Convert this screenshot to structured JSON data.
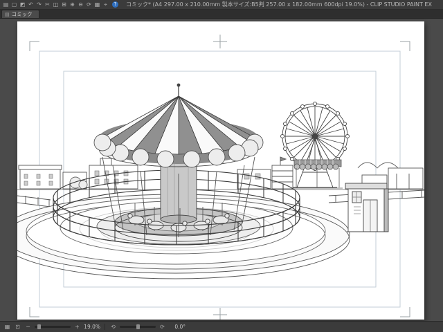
{
  "window": {
    "title": "コミック* (A4 297.00 x 210.00mm 製本サイズ:B5判 257.00 x 182.00mm 600dpi 19.0%) - CLIP STUDIO PAINT EX"
  },
  "toolbar": {
    "icons": [
      {
        "name": "page-manager",
        "glyph": "▤"
      },
      {
        "name": "new-canvas",
        "glyph": "▢"
      },
      {
        "name": "save",
        "glyph": "◩"
      },
      {
        "name": "undo",
        "glyph": "↶"
      },
      {
        "name": "redo",
        "glyph": "↷"
      },
      {
        "name": "cut",
        "glyph": "✂"
      },
      {
        "name": "copy",
        "glyph": "◫"
      },
      {
        "name": "paste",
        "glyph": "⊞"
      },
      {
        "name": "zoom-in",
        "glyph": "⊕"
      },
      {
        "name": "zoom-out",
        "glyph": "⊖"
      },
      {
        "name": "rotate-view",
        "glyph": "⟳"
      },
      {
        "name": "grid",
        "glyph": "▦"
      },
      {
        "name": "snap",
        "glyph": "⌖"
      }
    ],
    "help_glyph": "?"
  },
  "tab": {
    "label": "コミック",
    "icon_glyph": "▤"
  },
  "statusbar": {
    "icons": {
      "navigator": "▦",
      "fit_screen": "⊡",
      "zoom_out": "−",
      "zoom_in": "+",
      "rotate_ccw": "⟲",
      "rotate_cw": "⟳"
    },
    "zoom_value": "19.0%",
    "rotation_value": "0.0°"
  },
  "colors": {
    "titlebar_bg": "#3b3b3b",
    "canvas_bg": "#4a4a4a",
    "page_bg": "#ffffff",
    "guide_line": "#c3ced7",
    "crop_mark": "#9aa0a4",
    "help_badge": "#2f6fbf"
  }
}
